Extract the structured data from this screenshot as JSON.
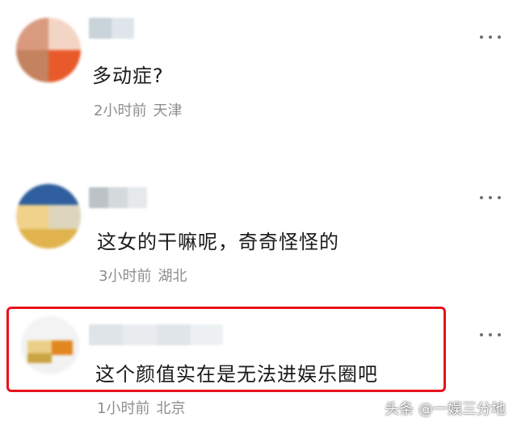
{
  "comments": [
    {
      "text": "多动症?",
      "time": "2小时前",
      "location": "天津"
    },
    {
      "text": "这女的干嘛呢，奇奇怪怪的",
      "time": "3小时前",
      "location": "湖北"
    },
    {
      "text": "这个颜值实在是无法进娱乐圈吧",
      "time": "1小时前",
      "location": "北京"
    }
  ],
  "colors": {
    "highlight": "#e8121b",
    "meta_text": "#8e8e8e",
    "body_text": "#1a1a1a"
  },
  "icons": {
    "more": "more-options-icon"
  },
  "watermark": "头条 @一娱三分地"
}
